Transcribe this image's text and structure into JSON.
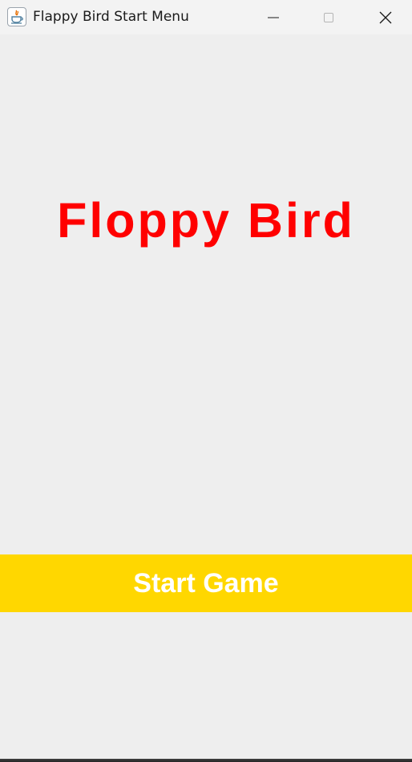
{
  "window": {
    "title": "Flappy Bird Start Menu",
    "icon": "java-icon",
    "controls": {
      "minimize_icon": "minimize-icon",
      "maximize_icon": "maximize-icon",
      "close_icon": "close-icon"
    }
  },
  "main": {
    "game_title": "Floppy Bird",
    "start_button_label": "Start Game"
  },
  "colors": {
    "title": "#ff0000",
    "start_button_bg": "#ffd700",
    "start_button_text": "#ffffff",
    "background": "#eeeeee"
  }
}
